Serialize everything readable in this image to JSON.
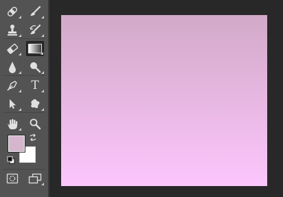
{
  "app": "image-editor",
  "toolbar": {
    "tools": [
      {
        "name": "spot-healing-brush-tool",
        "icon": "bandage-icon",
        "active": false
      },
      {
        "name": "brush-tool",
        "icon": "brush-icon",
        "active": false
      },
      {
        "name": "clone-stamp-tool",
        "icon": "stamp-icon",
        "active": false
      },
      {
        "name": "history-brush-tool",
        "icon": "history-brush-icon",
        "active": false
      },
      {
        "name": "eraser-tool",
        "icon": "eraser-icon",
        "active": false
      },
      {
        "name": "gradient-tool",
        "icon": "gradient-icon",
        "active": true
      },
      {
        "name": "blur-tool",
        "icon": "blur-drop-icon",
        "active": false
      },
      {
        "name": "dodge-tool",
        "icon": "dodge-icon",
        "active": false
      },
      {
        "name": "pen-tool",
        "icon": "pen-icon",
        "active": false
      },
      {
        "name": "type-tool",
        "icon": "type-icon",
        "glyph": "T",
        "active": false
      },
      {
        "name": "path-selection-tool",
        "icon": "arrow-pointer-icon",
        "active": false
      },
      {
        "name": "custom-shape-tool",
        "icon": "blob-shape-icon",
        "active": false
      },
      {
        "name": "hand-tool",
        "icon": "hand-icon",
        "active": false
      },
      {
        "name": "zoom-tool",
        "icon": "magnifier-icon",
        "active": false
      },
      {
        "name": "quick-mask-mode",
        "icon": "quick-mask-icon",
        "active": false
      },
      {
        "name": "screen-mode",
        "icon": "screen-mode-icon",
        "active": false
      }
    ],
    "colors": {
      "foreground": "#d5b6cd",
      "background": "#ffffff"
    }
  },
  "canvas": {
    "gradient_top": "#d2a9c8",
    "gradient_bottom": "#fcc6fc"
  },
  "theme": {
    "toolbar_bg": "#535353",
    "workspace_bg": "#282828",
    "icon_color": "#e0e0e0"
  }
}
